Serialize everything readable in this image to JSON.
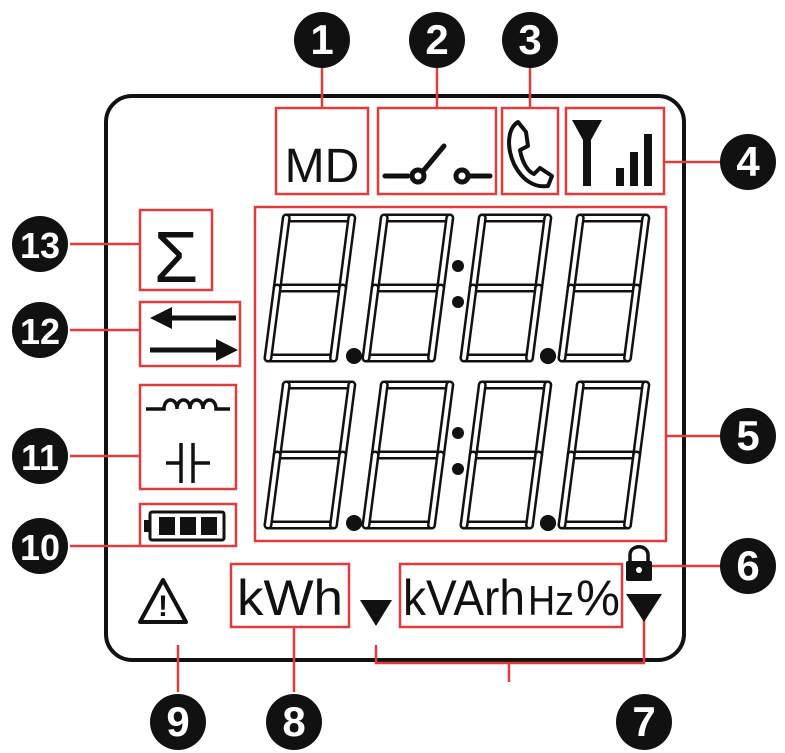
{
  "colors": {
    "outline": "#111111",
    "highlight": "#e03c3c",
    "callout_fill": "#111111",
    "callout_text": "#ffffff",
    "background": "#ffffff"
  },
  "indicators": {
    "md_label": "MD",
    "unit_kwh": "kWh",
    "unit_kvarh": "kVArh",
    "unit_hz": "Hz",
    "unit_percent": "%",
    "sigma": "Σ",
    "warning_mark": "!",
    "digits_row1": "8.8:8.8",
    "digits_row2": "8.8:8.8"
  },
  "icons": {
    "md": "md-indicator",
    "switch": "switch-icon",
    "phone": "phone-icon",
    "signal": "signal-strength-icon",
    "sigma": "sigma-icon",
    "arrows": "bidirectional-arrows-icon",
    "inductor": "inductor-icon",
    "capacitor": "capacitor-icon",
    "battery": "battery-icon",
    "warning": "warning-icon",
    "lock": "lock-icon",
    "triangle_down": "triangle-down-icon"
  },
  "callouts": [
    "1",
    "2",
    "3",
    "4",
    "5",
    "6",
    "7",
    "8",
    "9",
    "10",
    "11",
    "12",
    "13"
  ]
}
